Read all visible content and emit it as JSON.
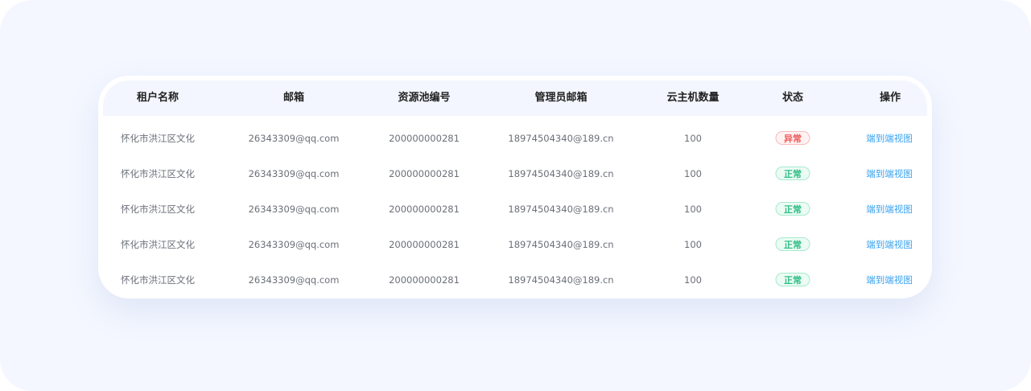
{
  "table": {
    "columns": [
      "租户名称",
      "邮箱",
      "资源池编号",
      "管理员邮箱",
      "云主机数量",
      "状态",
      "操作"
    ],
    "rows": [
      {
        "tenant": "怀化市洪江区文化",
        "email": "26343309@qq.com",
        "pool_id": "200000000281",
        "admin_email": "18974504340@189.cn",
        "vm_count": "100",
        "status": "异常",
        "status_type": "abnormal",
        "action": "端到端视图"
      },
      {
        "tenant": "怀化市洪江区文化",
        "email": "26343309@qq.com",
        "pool_id": "200000000281",
        "admin_email": "18974504340@189.cn",
        "vm_count": "100",
        "status": "正常",
        "status_type": "normal",
        "action": "端到端视图"
      },
      {
        "tenant": "怀化市洪江区文化",
        "email": "26343309@qq.com",
        "pool_id": "200000000281",
        "admin_email": "18974504340@189.cn",
        "vm_count": "100",
        "status": "正常",
        "status_type": "normal",
        "action": "端到端视图"
      },
      {
        "tenant": "怀化市洪江区文化",
        "email": "26343309@qq.com",
        "pool_id": "200000000281",
        "admin_email": "18974504340@189.cn",
        "vm_count": "100",
        "status": "正常",
        "status_type": "normal",
        "action": "端到端视图"
      },
      {
        "tenant": "怀化市洪江区文化",
        "email": "26343309@qq.com",
        "pool_id": "200000000281",
        "admin_email": "18974504340@189.cn",
        "vm_count": "100",
        "status": "正常",
        "status_type": "normal",
        "action": "端到端视图"
      }
    ]
  },
  "colors": {
    "page_background": "#f4f7ff",
    "header_background": "#f3f6fe",
    "normal": "#2fbf85",
    "abnormal": "#ef5b5b",
    "link": "#3aa2ee"
  }
}
